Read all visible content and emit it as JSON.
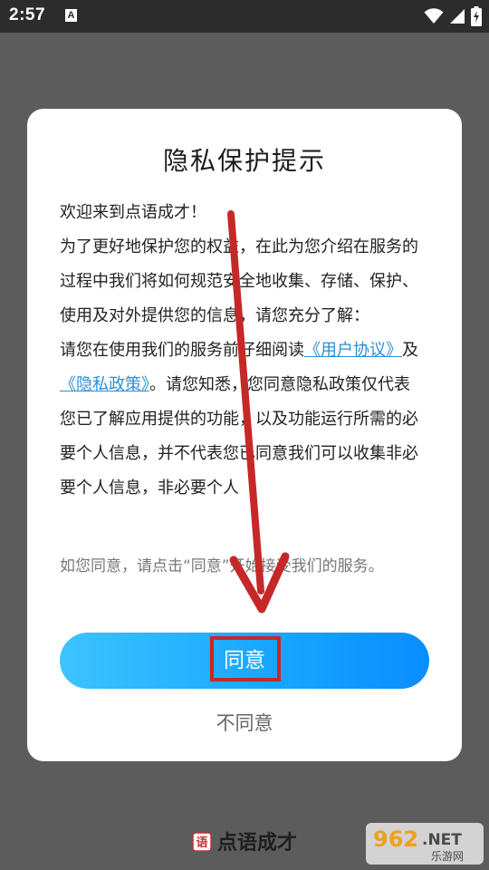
{
  "status_bar": {
    "time": "2:57",
    "notification_glyph": "A",
    "icons": [
      "wifi-icon",
      "signal-icon",
      "battery-charging-icon"
    ]
  },
  "dialog": {
    "title": "隐私保护提示",
    "body_paragraphs": {
      "greeting": "欢迎来到点语成才！",
      "intro": "为了更好地保护您的权益，在此为您介绍在服务的过程中我们将如何规范安全地收集、存储、保护、使用及对外提供您的信息，请您充分了解：",
      "read_prefix": "请您在使用我们的服务前仔细阅读",
      "user_agreement_link": "《用户协议》",
      "and": "及",
      "privacy_policy_link": "《隐私政策》",
      "read_suffix": "。请您知悉，您同意隐私政策仅代表您已了解应用提供的功能，以及功能运行所需的必要个人信息，并不代表您已同意我们可以收集非必要个人信息，非必要个人"
    },
    "note": "如您同意，请点击“同意”开始接受我们的服务。",
    "agree_label": "同意",
    "disagree_label": "不同意"
  },
  "footer": {
    "logo_mark": "语",
    "logo_text": "点语成才"
  },
  "watermark": {
    "number": "962",
    "suffix": ".NET",
    "subtitle": "乐游网"
  },
  "colors": {
    "link": "#2a8fd8",
    "agree_gradient_start": "#3ec3ff",
    "agree_gradient_end": "#0a8dff",
    "annotation_red": "#c62828"
  }
}
